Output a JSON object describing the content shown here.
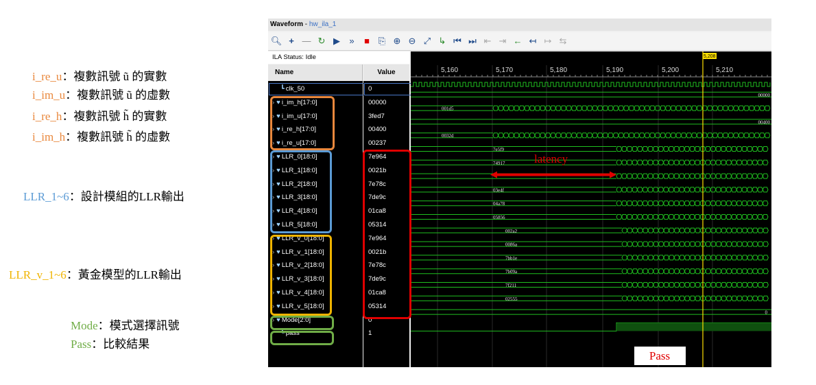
{
  "annotations": {
    "i_re_u": {
      "key": "i_re_u",
      "desc": "：複數訊號 ũ 的實數"
    },
    "i_im_u": {
      "key": "i_im_u",
      "desc": "：複數訊號 ũ 的虛數"
    },
    "i_re_h": {
      "key": "i_re_h",
      "desc": "：複數訊號 h̃ 的實數"
    },
    "i_im_h": {
      "key": "i_im_h",
      "desc": "：複數訊號 h̃ 的虛數"
    },
    "llr": {
      "key": "LLR_1~6",
      "desc": "：設計模組的LLR輸出"
    },
    "llr_v": {
      "key": "LLR_v_1~6",
      "desc": "：黃金模型的LLR輸出"
    },
    "mode": {
      "key": "Mode",
      "desc": "：模式選擇訊號"
    },
    "pass": {
      "key": "Pass",
      "desc": "：比較結果"
    }
  },
  "window": {
    "title": "Waveform",
    "subtitle": "hw_ila_1",
    "status": "ILA Status: Idle",
    "col_name": "Name",
    "col_value": "Value"
  },
  "signals": [
    {
      "name": "clk_50",
      "value": "0",
      "kind": "bit",
      "expand": false
    },
    {
      "name": "i_im_h[17:0]",
      "value": "00000",
      "kind": "bus",
      "expand": true
    },
    {
      "name": "i_im_u[17:0]",
      "value": "3fed7",
      "kind": "bus",
      "expand": true
    },
    {
      "name": "i_re_h[17:0]",
      "value": "00400",
      "kind": "bus",
      "expand": true
    },
    {
      "name": "i_re_u[17:0]",
      "value": "00237",
      "kind": "bus",
      "expand": true
    },
    {
      "name": "LLR_0[18:0]",
      "value": "7e964",
      "kind": "bus",
      "expand": true
    },
    {
      "name": "LLR_1[18:0]",
      "value": "0021b",
      "kind": "bus",
      "expand": true
    },
    {
      "name": "LLR_2[18:0]",
      "value": "7e78c",
      "kind": "bus",
      "expand": true
    },
    {
      "name": "LLR_3[18:0]",
      "value": "7de9c",
      "kind": "bus",
      "expand": true
    },
    {
      "name": "LLR_4[18:0]",
      "value": "01ca8",
      "kind": "bus",
      "expand": true
    },
    {
      "name": "LLR_5[18:0]",
      "value": "05314",
      "kind": "bus",
      "expand": true
    },
    {
      "name": "LLR_v_0[18:0]",
      "value": "7e964",
      "kind": "bus",
      "expand": true
    },
    {
      "name": "LLR_v_1[18:0]",
      "value": "0021b",
      "kind": "bus",
      "expand": true
    },
    {
      "name": "LLR_v_2[18:0]",
      "value": "7e78c",
      "kind": "bus",
      "expand": true
    },
    {
      "name": "LLR_v_3[18:0]",
      "value": "7de9c",
      "kind": "bus",
      "expand": true
    },
    {
      "name": "LLR_v_4[18:0]",
      "value": "01ca8",
      "kind": "bus",
      "expand": true
    },
    {
      "name": "LLR_v_5[18:0]",
      "value": "05314",
      "kind": "bus",
      "expand": true
    },
    {
      "name": "Mode[2:0]",
      "value": "0",
      "kind": "bus",
      "expand": true
    },
    {
      "name": "pass",
      "value": "1",
      "kind": "bit",
      "expand": false
    }
  ],
  "timeline": {
    "ticks": [
      "5,160",
      "5,170",
      "5,180",
      "5,190",
      "5,200",
      "5,210"
    ],
    "cursor": "5,208"
  },
  "wave_labels": {
    "i_im_h": "00000",
    "i_im_u": "001d5",
    "i_re_h": "00400",
    "i_re_u": "0032d",
    "LLR_0": "7e5f9",
    "LLR_1": "74917",
    "LLR_3": "03e4f",
    "LLR_4": "04a78",
    "LLR_5": "05856",
    "LLR_v_0": "002a2",
    "LLR_v_1": "0086a",
    "LLR_v_2": "7bb1e",
    "LLR_v_3": "7b09a",
    "LLR_v_4": "7f211",
    "LLR_v_5": "02555",
    "Mode": "0"
  },
  "latency_label": "latency",
  "pass_label": "Pass",
  "colors": {
    "wave": "#1fbf1f",
    "cursor": "#ffe000",
    "red": "#e00000"
  }
}
